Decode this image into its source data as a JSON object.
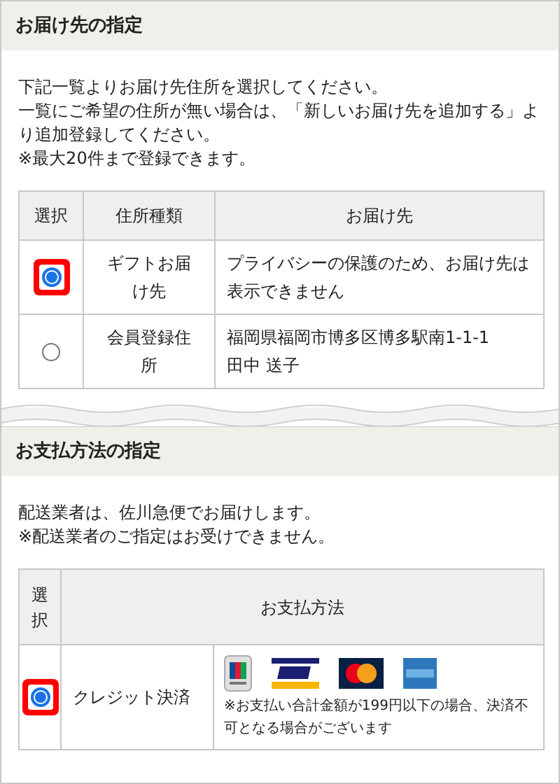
{
  "delivery": {
    "title": "お届け先の指定",
    "notes": [
      "下記一覧よりお届け先住所を選択してください。",
      "一覧にご希望の住所が無い場合は、「新しいお届け先を追加する」より追加登録してください。",
      "※最大20件まで登録できます。"
    ],
    "table": {
      "columns": [
        "選択",
        "住所種類",
        "お届け先"
      ],
      "rows": [
        {
          "selected": true,
          "type": "ギフトお届け先",
          "address": [
            "プライバシーの保護のため、お届け先は表示できません"
          ]
        },
        {
          "selected": false,
          "type": "会員登録住所",
          "address": [
            "福岡県福岡市博多区博多駅南1-1-1",
            "田中 送子"
          ]
        }
      ]
    }
  },
  "payment": {
    "title": "お支払方法の指定",
    "notes": [
      "配送業者は、佐川急便でお届けします。",
      "※配送業者のご指定はお受けできません。"
    ],
    "table": {
      "columns": [
        "選択",
        "お支払方法"
      ],
      "rows": [
        {
          "selected": true,
          "method": "クレジット決済",
          "cards": [
            {
              "kind": "jcb"
            },
            {
              "kind": "visa"
            },
            {
              "kind": "master"
            },
            {
              "kind": "amex"
            }
          ],
          "note": "※お支払い合計金額が199円以下の場合、決済不可となる場合がございます"
        }
      ]
    }
  }
}
